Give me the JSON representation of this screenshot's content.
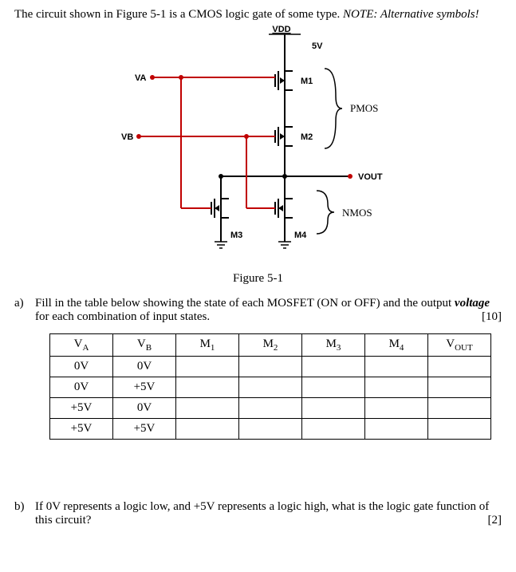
{
  "intro_main": "The circuit shown in Figure 5-1 is a CMOS logic gate of some type. ",
  "intro_note": "NOTE: Alternative symbols!",
  "figure": {
    "caption": "Figure 5-1",
    "labels": {
      "vdd": "VDD",
      "vdd_val": "5V",
      "va": "VA",
      "vb": "VB",
      "m1": "M1",
      "m2": "M2",
      "m3": "M3",
      "m4": "M4",
      "pmos": "PMOS",
      "nmos": "NMOS",
      "vout": "VOUT"
    }
  },
  "part_a": {
    "label": "a)",
    "text_1": "Fill in the table below showing the state of each MOSFET (ON or OFF) and the output ",
    "text_bold": "voltage",
    "text_2": " for each combination of input states.",
    "marks": "[10]"
  },
  "table": {
    "headers": [
      "V_A",
      "V_B",
      "M_1",
      "M_2",
      "M_3",
      "M_4",
      "V_OUT"
    ],
    "rows": [
      [
        "0V",
        "0V",
        "",
        "",
        "",
        "",
        ""
      ],
      [
        "0V",
        "+5V",
        "",
        "",
        "",
        "",
        ""
      ],
      [
        "+5V",
        "0V",
        "",
        "",
        "",
        "",
        ""
      ],
      [
        "+5V",
        "+5V",
        "",
        "",
        "",
        "",
        ""
      ]
    ]
  },
  "part_b": {
    "label": "b)",
    "text": "If 0V represents a logic low, and +5V represents a logic high, what is the logic gate function of this circuit?",
    "marks": "[2]"
  }
}
